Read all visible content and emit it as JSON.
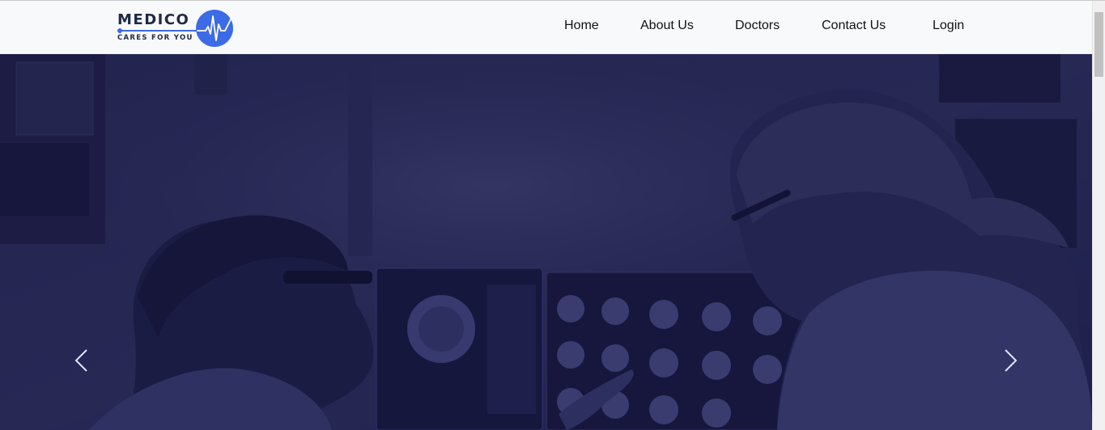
{
  "brand": {
    "name": "MEDICO",
    "tagline": "CARES FOR YOU",
    "logo_icon": "heartbeat-icon",
    "accent_color": "#3d6be5"
  },
  "nav": {
    "items": [
      {
        "label": "Home"
      },
      {
        "label": "About Us"
      },
      {
        "label": "Doctors"
      },
      {
        "label": "Contact Us"
      },
      {
        "label": "Login"
      }
    ]
  },
  "hero": {
    "image_subject": "doctors reviewing brain scans",
    "overlay_color": "#1a1a5a",
    "prev_icon": "chevron-left-icon",
    "next_icon": "chevron-right-icon"
  }
}
